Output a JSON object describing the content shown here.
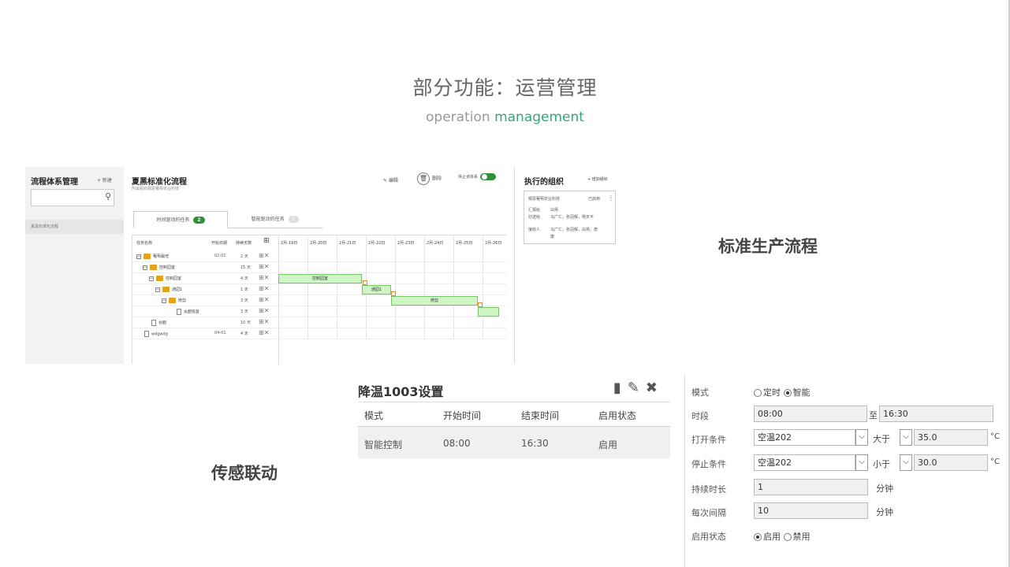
{
  "header": {
    "title": "部分功能：运营管理",
    "subtitle_prefix": "operation ",
    "subtitle_accent": "management"
  },
  "labels": {
    "standard_process": "标准生产流程",
    "sensor_linkage": "传感联动"
  },
  "process": {
    "sidebar": {
      "title": "流程体系管理",
      "new_label": "+ 新建",
      "items": [
        {
          "label": "夏黑标准化流程"
        }
      ]
    },
    "main": {
      "title": "夏黑标准化流程",
      "subtitle": "所属组织桐思葡萄农业科技",
      "edit_label": "编辑",
      "delete_label": "删除",
      "stop_label": "停止该体系",
      "tabs": [
        {
          "label": "时间驱动的任务",
          "count": "2"
        },
        {
          "label": "智能驱动的任务",
          "count": "0"
        }
      ],
      "gantt": {
        "columns": {
          "name": "任务名称",
          "start": "开始日期",
          "duration": "持续天数"
        },
        "days": [
          "2月-19日",
          "2月-20日",
          "2月-21日",
          "2月-22日",
          "2月-23日",
          "2月-24日",
          "2月-25日",
          "2月-26日"
        ],
        "rows": [
          {
            "name": "葡萄栽培",
            "start": "02-01",
            "duration": "2 天"
          },
          {
            "name": "控制园室",
            "start": "",
            "duration": "15 天"
          },
          {
            "name": "控制园室",
            "start": "",
            "duration": "4 天"
          },
          {
            "name": "通园1",
            "start": "",
            "duration": "1 天"
          },
          {
            "name": "修剪",
            "start": "",
            "duration": "3 天"
          },
          {
            "name": "水肥恢复",
            "start": "",
            "duration": "3 天"
          },
          {
            "name": "补肥",
            "start": "",
            "duration": "10 天"
          },
          {
            "name": "wdgwdg",
            "start": "04-01",
            "duration": "4 天"
          }
        ],
        "bars": [
          "控制园室",
          "通园1",
          "修剪"
        ]
      }
    },
    "orgs": {
      "title": "执行的组织",
      "add_label": "+ 增加组织",
      "card": {
        "name": "桐思葡萄农业科技",
        "status": "已启用",
        "reporter_label": "汇报给",
        "reporter": "白扬",
        "cc_label": "抄送给",
        "cc": "马广仁，张冠辉，杨天平",
        "receiver_label": "接收人",
        "receiver_line1": "马广仁，张冠辉，白扬，唐",
        "receiver_line2": "康"
      }
    }
  },
  "cooling": {
    "title": "降温1003设置",
    "headers": [
      "模式",
      "开始时间",
      "结束时间",
      "启用状态"
    ],
    "rows": [
      [
        "智能控制",
        "08:00",
        "16:30",
        "启用"
      ]
    ]
  },
  "form": {
    "mode_label": "模式",
    "mode_options": [
      "定时",
      "智能"
    ],
    "mode_selected": "智能",
    "period_label": "时段",
    "period_start": "08:00",
    "period_to": "至",
    "period_end": "16:30",
    "open_label": "打开条件",
    "open_sensor": "空温202",
    "open_op": "大于",
    "open_value": "35.0",
    "stop_label": "停止条件",
    "stop_sensor": "空温202",
    "stop_op": "小于",
    "stop_value": "30.0",
    "unit_temp": "°C",
    "duration_label": "持续时长",
    "duration_value": "1",
    "interval_label": "每次间隔",
    "interval_value": "10",
    "unit_minute": "分钟",
    "status_label": "启用状态",
    "status_options": [
      "启用",
      "禁用"
    ],
    "status_selected": "启用"
  }
}
